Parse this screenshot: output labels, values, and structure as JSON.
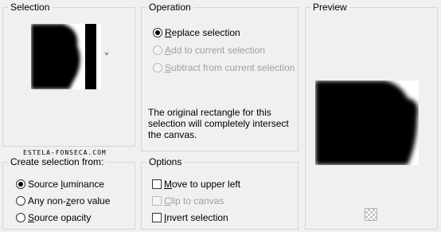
{
  "selection_group": {
    "title": "Selection",
    "watermark": "ESTELA-FONSECA.COM"
  },
  "operation_group": {
    "title": "Operation",
    "options": [
      {
        "prefix": "",
        "key": "R",
        "rest": "eplace selection",
        "checked": true,
        "enabled": true
      },
      {
        "prefix": "",
        "key": "A",
        "rest": "dd to current selection",
        "checked": false,
        "enabled": false
      },
      {
        "prefix": "",
        "key": "S",
        "rest": "ubtract from current selection",
        "checked": false,
        "enabled": false
      }
    ],
    "info": "The original rectangle for this selection will completely intersect the canvas."
  },
  "preview_group": {
    "title": "Preview"
  },
  "create_group": {
    "title": "Create selection from:",
    "options": [
      {
        "prefix": "Source ",
        "key": "l",
        "rest": "uminance",
        "checked": true
      },
      {
        "prefix": "Any non-",
        "key": "z",
        "rest": "ero value",
        "checked": false
      },
      {
        "prefix": "",
        "key": "S",
        "rest": "ource opacity",
        "checked": false
      }
    ]
  },
  "options_group": {
    "title": "Options",
    "items": [
      {
        "prefix": "",
        "key": "M",
        "rest": "ove to upper left",
        "checked": false,
        "enabled": true
      },
      {
        "prefix": "",
        "key": "C",
        "rest": "lip to canvas",
        "checked": false,
        "enabled": false
      },
      {
        "prefix": "",
        "key": "I",
        "rest": "nvert selection",
        "checked": false,
        "enabled": true
      }
    ]
  },
  "colors": {
    "border": "#d5d5d5",
    "background": "#f0f0f0",
    "disabled_text": "#a0a0a0"
  }
}
